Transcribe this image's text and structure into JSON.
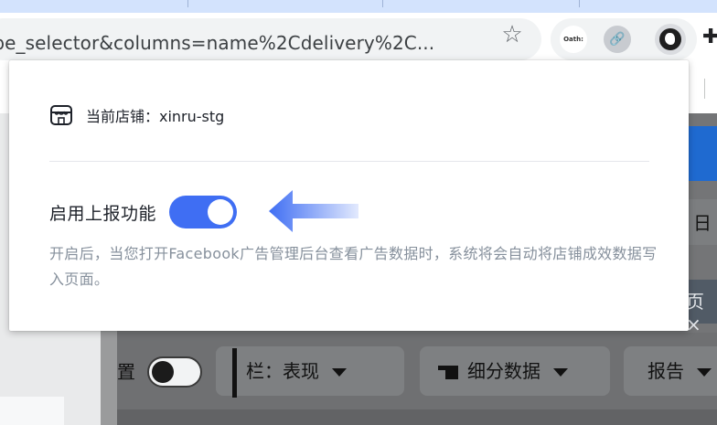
{
  "browser": {
    "url_text": "ope_selector&columns=name%2Cdelivery%2C...",
    "extensions": {
      "oath_label": "Oath:",
      "icons": [
        "star-icon",
        "oath-extension-icon",
        "link-extension-icon",
        "bird-extension-icon",
        "puzzle-icon"
      ]
    }
  },
  "popup": {
    "shop_label": "当前店铺：xinru-stg",
    "feature_label": "启用上报功能",
    "toggle_state": "on",
    "description": "开启后，当您打开Facebook广告管理后台查看广告数据时，系统将会自动将店铺成效数据写入页面。",
    "colors": {
      "accent": "#3f6ef3",
      "text": "#1d2129",
      "muted": "#86909c"
    }
  },
  "background_page": {
    "day_label": "日",
    "page_tab_label": "页 ×",
    "toggle_label": "置",
    "columns_button": "栏：表现",
    "breakdown_button": "细分数据",
    "reports_button": "报告"
  }
}
